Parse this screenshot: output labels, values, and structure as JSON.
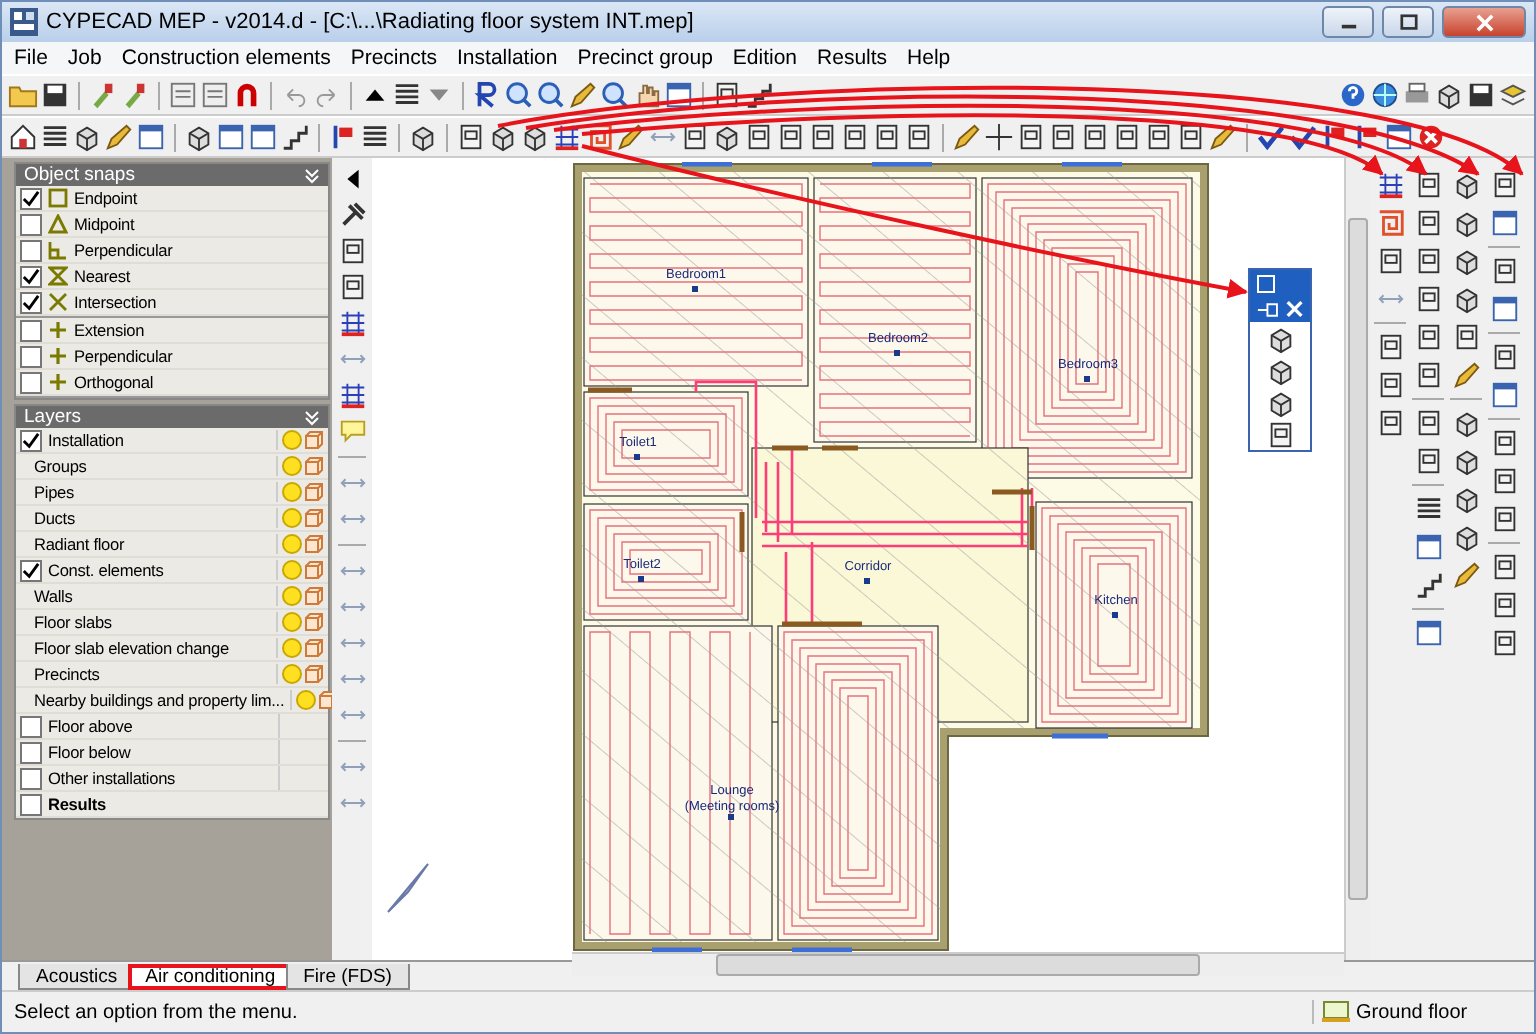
{
  "window": {
    "title": "CYPECAD MEP - v2014.d - [C:\\...\\Radiating floor system INT.mep]"
  },
  "menu": [
    "File",
    "Job",
    "Construction elements",
    "Precincts",
    "Installation",
    "Precinct group",
    "Edition",
    "Results",
    "Help"
  ],
  "object_snaps": {
    "title": "Object snaps",
    "groups": [
      {
        "items": [
          {
            "label": "Endpoint",
            "checked": true
          },
          {
            "label": "Midpoint",
            "checked": false
          },
          {
            "label": "Perpendicular",
            "checked": false
          },
          {
            "label": "Nearest",
            "checked": true
          },
          {
            "label": "Intersection",
            "checked": true
          }
        ]
      },
      {
        "items": [
          {
            "label": "Extension",
            "checked": false
          },
          {
            "label": "Perpendicular",
            "checked": false
          },
          {
            "label": "Orthogonal",
            "checked": false
          }
        ]
      }
    ]
  },
  "layers": {
    "title": "Layers",
    "items": [
      {
        "label": "Installation",
        "kind": "layer",
        "checked": true,
        "children": [
          {
            "label": "Groups"
          },
          {
            "label": "Pipes"
          },
          {
            "label": "Ducts"
          },
          {
            "label": "Radiant floor"
          }
        ]
      },
      {
        "label": "Const. elements",
        "kind": "layer",
        "checked": true,
        "children": [
          {
            "label": "Walls"
          },
          {
            "label": "Floor slabs"
          },
          {
            "label": "Floor slab elevation change"
          },
          {
            "label": "Precincts"
          },
          {
            "label": "Nearby buildings and property lim..."
          }
        ]
      },
      {
        "label": "Floor above",
        "kind": "reference",
        "checked": false
      },
      {
        "label": "Floor below",
        "kind": "reference",
        "checked": false
      },
      {
        "label": "Other installations",
        "kind": "reference",
        "checked": false
      },
      {
        "label": "Results",
        "kind": "summary",
        "checked": false
      }
    ]
  },
  "plan": {
    "rooms": [
      {
        "label": "Bedroom1"
      },
      {
        "label": "Bedroom2"
      },
      {
        "label": "Bedroom3"
      },
      {
        "label": "Toilet1"
      },
      {
        "label": "Toilet2"
      },
      {
        "label": "Corridor"
      },
      {
        "label": "Kitchen"
      },
      {
        "label": "Lounge",
        "sublabel": "(Meeting rooms)"
      }
    ]
  },
  "view_tabs": [
    {
      "label": "Acoustics",
      "selected": false,
      "highlighted": false
    },
    {
      "label": "Air conditioning",
      "selected": true,
      "highlighted": true
    },
    {
      "label": "Fire (FDS)",
      "selected": false,
      "highlighted": false
    }
  ],
  "status_bar": {
    "message": "Select an option from the menu.",
    "floor": "Ground floor"
  }
}
